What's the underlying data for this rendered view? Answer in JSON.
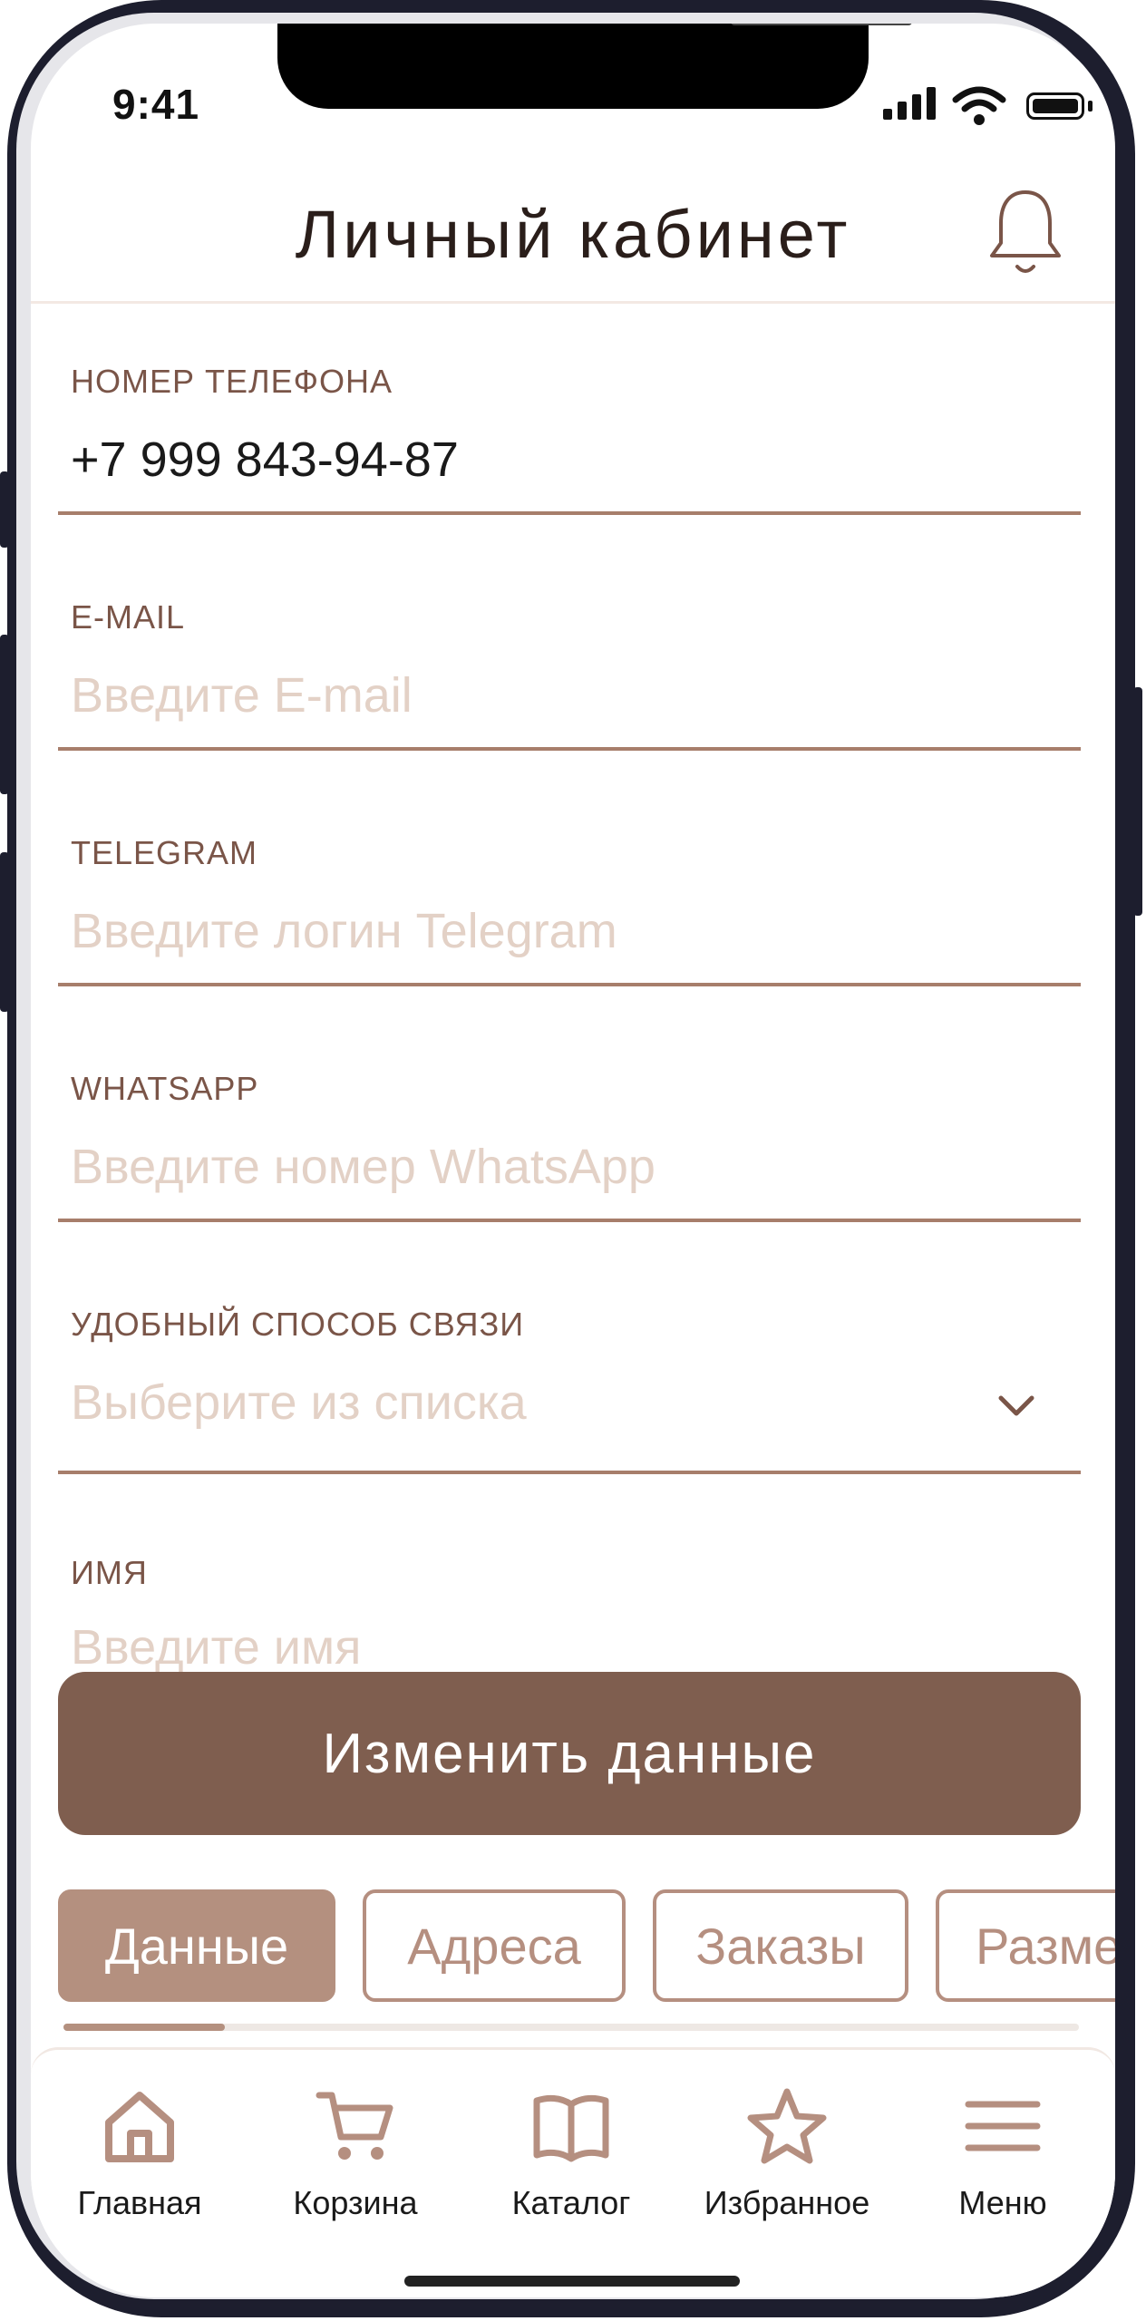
{
  "status_bar": {
    "time": "9:41"
  },
  "header": {
    "title": "Личный кабинет"
  },
  "form": {
    "phone": {
      "label": "НОМЕР ТЕЛЕФОНА",
      "value": "+7 999 843-94-87"
    },
    "email": {
      "label": "E-MAIL",
      "placeholder": "Введите E-mail"
    },
    "telegram": {
      "label": "TELEGRAM",
      "placeholder": "Введите логин Telegram"
    },
    "whatsapp": {
      "label": "WHATSAPP",
      "placeholder": "Введите номер WhatsApp"
    },
    "contact_method": {
      "label": "УДОБНЫЙ СПОСОБ СВЯЗИ",
      "placeholder": "Выберите из списка"
    },
    "name": {
      "label": "ИМЯ",
      "placeholder": "Введите имя"
    }
  },
  "primary_button": {
    "label": "Изменить данные"
  },
  "tabs": [
    {
      "label": "Данные",
      "active": true
    },
    {
      "label": "Адреса",
      "active": false
    },
    {
      "label": "Заказы",
      "active": false
    },
    {
      "label": "Размеры",
      "active": false
    }
  ],
  "bottom_nav": [
    {
      "label": "Главная",
      "icon": "home-icon"
    },
    {
      "label": "Корзина",
      "icon": "cart-icon"
    },
    {
      "label": "Каталог",
      "icon": "book-icon"
    },
    {
      "label": "Избранное",
      "icon": "star-icon"
    },
    {
      "label": "Меню",
      "icon": "menu-icon"
    }
  ],
  "colors": {
    "accent": "#7f5e4f",
    "accent_light": "#b4907f",
    "label": "#7a5548",
    "placeholder": "#e3d1c6",
    "divider": "#a77e6b"
  }
}
